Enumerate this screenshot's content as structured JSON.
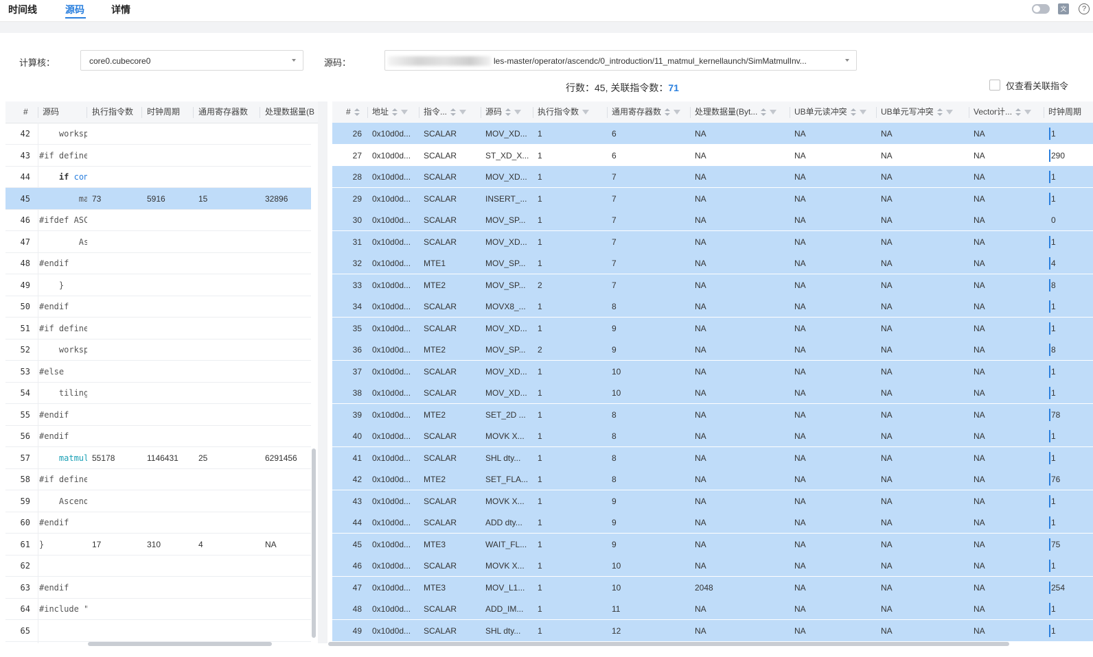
{
  "tabs": {
    "timeline": "时间线",
    "source": "源码",
    "details": "详情"
  },
  "controls": {
    "core_label": "计算核：",
    "core_value": "core0.cubecore0",
    "source_label": "源码：",
    "source_value": "les-master/operator/ascendc/0_introduction/11_matmul_kernellaunch/SimMatmulInv...",
    "summary_prefix": "行数：45, 关联指令数：",
    "summary_count": "71",
    "only_related_label": "仅查看关联指令"
  },
  "left_table": {
    "columns": [
      "#",
      "源码",
      "执行指令数",
      "时钟周期",
      "通用寄存器数",
      "处理数据量(B"
    ],
    "rows": [
      {
        "line": "42",
        "code": "    worksp",
        "exec": "",
        "cycles": "",
        "regs": "",
        "data": "",
        "sel": false
      },
      {
        "line": "43",
        "code": "#if define",
        "exec": "",
        "cycles": "",
        "regs": "",
        "data": "",
        "sel": false
      },
      {
        "line": "44",
        "code": "    if con",
        "exec": "",
        "cycles": "",
        "regs": "",
        "data": "",
        "sel": false
      },
      {
        "line": "45",
        "code": "        ma",
        "exec": "73",
        "cycles": "5916",
        "regs": "15",
        "data": "32896",
        "sel": true
      },
      {
        "line": "46",
        "code": "#ifdef ASC",
        "exec": "",
        "cycles": "",
        "regs": "",
        "data": "",
        "sel": false
      },
      {
        "line": "47",
        "code": "        As",
        "exec": "",
        "cycles": "",
        "regs": "",
        "data": "",
        "sel": false
      },
      {
        "line": "48",
        "code": "#endif",
        "exec": "",
        "cycles": "",
        "regs": "",
        "data": "",
        "sel": false
      },
      {
        "line": "49",
        "code": "    }",
        "exec": "",
        "cycles": "",
        "regs": "",
        "data": "",
        "sel": false
      },
      {
        "line": "50",
        "code": "#endif",
        "exec": "",
        "cycles": "",
        "regs": "",
        "data": "",
        "sel": false
      },
      {
        "line": "51",
        "code": "#if define",
        "exec": "",
        "cycles": "",
        "regs": "",
        "data": "",
        "sel": false
      },
      {
        "line": "52",
        "code": "    worksp",
        "exec": "",
        "cycles": "",
        "regs": "",
        "data": "",
        "sel": false
      },
      {
        "line": "53",
        "code": "#else",
        "exec": "",
        "cycles": "",
        "regs": "",
        "data": "",
        "sel": false
      },
      {
        "line": "54",
        "code": "    tiling",
        "exec": "",
        "cycles": "",
        "regs": "",
        "data": "",
        "sel": false
      },
      {
        "line": "55",
        "code": "#endif",
        "exec": "",
        "cycles": "",
        "regs": "",
        "data": "",
        "sel": false
      },
      {
        "line": "56",
        "code": "#endif",
        "exec": "",
        "cycles": "",
        "regs": "",
        "data": "",
        "sel": false
      },
      {
        "line": "57",
        "code": "    matmul",
        "exec": "55178",
        "cycles": "1146431",
        "regs": "25",
        "data": "6291456",
        "sel": false
      },
      {
        "line": "58",
        "code": "#if define",
        "exec": "",
        "cycles": "",
        "regs": "",
        "data": "",
        "sel": false
      },
      {
        "line": "59",
        "code": "    Ascend",
        "exec": "",
        "cycles": "",
        "regs": "",
        "data": "",
        "sel": false
      },
      {
        "line": "60",
        "code": "#endif",
        "exec": "",
        "cycles": "",
        "regs": "",
        "data": "",
        "sel": false
      },
      {
        "line": "61",
        "code": "}",
        "exec": "17",
        "cycles": "310",
        "regs": "4",
        "data": "NA",
        "sel": false
      },
      {
        "line": "62",
        "code": "",
        "exec": "",
        "cycles": "",
        "regs": "",
        "data": "",
        "sel": false
      },
      {
        "line": "63",
        "code": "#endif",
        "exec": "",
        "cycles": "",
        "regs": "",
        "data": "",
        "sel": false
      },
      {
        "line": "64",
        "code": "#include \"",
        "exec": "",
        "cycles": "",
        "regs": "",
        "data": "",
        "sel": false
      },
      {
        "line": "65",
        "code": "",
        "exec": "",
        "cycles": "",
        "regs": "",
        "data": "",
        "sel": false
      }
    ]
  },
  "right_table": {
    "columns": [
      "#",
      "地址",
      "指令...",
      "源码",
      "执行指令数",
      "通用寄存器数",
      "处理数据量(Byt...",
      "UB单元读冲突",
      "UB单元写冲突",
      "Vector计...",
      "时钟周期"
    ],
    "rows": [
      {
        "n": "26",
        "addr": "0x10d0d...",
        "pipe": "SCALAR",
        "instr": "MOV_XD...",
        "exec": "1",
        "regs": "6",
        "data": "NA",
        "ubr": "NA",
        "ubw": "NA",
        "vec": "NA",
        "clk": "1",
        "clk_frac": 0.003,
        "sel": true
      },
      {
        "n": "27",
        "addr": "0x10d0d...",
        "pipe": "SCALAR",
        "instr": "ST_XD_X...",
        "exec": "1",
        "regs": "6",
        "data": "NA",
        "ubr": "NA",
        "ubw": "NA",
        "vec": "NA",
        "clk": "290",
        "clk_frac": 0.003,
        "sel": false
      },
      {
        "n": "28",
        "addr": "0x10d0d...",
        "pipe": "SCALAR",
        "instr": "MOV_XD...",
        "exec": "1",
        "regs": "7",
        "data": "NA",
        "ubr": "NA",
        "ubw": "NA",
        "vec": "NA",
        "clk": "1",
        "clk_frac": 0.003,
        "sel": true
      },
      {
        "n": "29",
        "addr": "0x10d0d...",
        "pipe": "SCALAR",
        "instr": "INSERT_...",
        "exec": "1",
        "regs": "7",
        "data": "NA",
        "ubr": "NA",
        "ubw": "NA",
        "vec": "NA",
        "clk": "1",
        "clk_frac": 0.003,
        "sel": true
      },
      {
        "n": "30",
        "addr": "0x10d0d...",
        "pipe": "SCALAR",
        "instr": "MOV_SP...",
        "exec": "1",
        "regs": "7",
        "data": "NA",
        "ubr": "NA",
        "ubw": "NA",
        "vec": "NA",
        "clk": "0",
        "clk_frac": 0,
        "sel": true
      },
      {
        "n": "31",
        "addr": "0x10d0d...",
        "pipe": "SCALAR",
        "instr": "MOV_XD...",
        "exec": "1",
        "regs": "7",
        "data": "NA",
        "ubr": "NA",
        "ubw": "NA",
        "vec": "NA",
        "clk": "1",
        "clk_frac": 0.003,
        "sel": true
      },
      {
        "n": "32",
        "addr": "0x10d0d...",
        "pipe": "MTE1",
        "instr": "MOV_SP...",
        "exec": "1",
        "regs": "7",
        "data": "NA",
        "ubr": "NA",
        "ubw": "NA",
        "vec": "NA",
        "clk": "4",
        "clk_frac": 0.003,
        "sel": true
      },
      {
        "n": "33",
        "addr": "0x10d0d...",
        "pipe": "MTE2",
        "instr": "MOV_SP...",
        "exec": "2",
        "regs": "7",
        "data": "NA",
        "ubr": "NA",
        "ubw": "NA",
        "vec": "NA",
        "clk": "8",
        "clk_frac": 0.003,
        "sel": true
      },
      {
        "n": "34",
        "addr": "0x10d0d...",
        "pipe": "SCALAR",
        "instr": "MOVX8_...",
        "exec": "1",
        "regs": "8",
        "data": "NA",
        "ubr": "NA",
        "ubw": "NA",
        "vec": "NA",
        "clk": "1",
        "clk_frac": 0.003,
        "sel": true
      },
      {
        "n": "35",
        "addr": "0x10d0d...",
        "pipe": "SCALAR",
        "instr": "MOV_XD...",
        "exec": "1",
        "regs": "9",
        "data": "NA",
        "ubr": "NA",
        "ubw": "NA",
        "vec": "NA",
        "clk": "1",
        "clk_frac": 0.003,
        "sel": true
      },
      {
        "n": "36",
        "addr": "0x10d0d...",
        "pipe": "MTE2",
        "instr": "MOV_SP...",
        "exec": "2",
        "regs": "9",
        "data": "NA",
        "ubr": "NA",
        "ubw": "NA",
        "vec": "NA",
        "clk": "8",
        "clk_frac": 0.003,
        "sel": true
      },
      {
        "n": "37",
        "addr": "0x10d0d...",
        "pipe": "SCALAR",
        "instr": "MOV_XD...",
        "exec": "1",
        "regs": "10",
        "data": "NA",
        "ubr": "NA",
        "ubw": "NA",
        "vec": "NA",
        "clk": "1",
        "clk_frac": 0.003,
        "sel": true
      },
      {
        "n": "38",
        "addr": "0x10d0d...",
        "pipe": "SCALAR",
        "instr": "MOV_XD...",
        "exec": "1",
        "regs": "10",
        "data": "NA",
        "ubr": "NA",
        "ubw": "NA",
        "vec": "NA",
        "clk": "1",
        "clk_frac": 0.003,
        "sel": true
      },
      {
        "n": "39",
        "addr": "0x10d0d...",
        "pipe": "MTE2",
        "instr": "SET_2D ...",
        "exec": "1",
        "regs": "8",
        "data": "NA",
        "ubr": "NA",
        "ubw": "NA",
        "vec": "NA",
        "clk": "78",
        "clk_frac": 0.003,
        "sel": true
      },
      {
        "n": "40",
        "addr": "0x10d0d...",
        "pipe": "SCALAR",
        "instr": "MOVK X...",
        "exec": "1",
        "regs": "8",
        "data": "NA",
        "ubr": "NA",
        "ubw": "NA",
        "vec": "NA",
        "clk": "1",
        "clk_frac": 0.003,
        "sel": true
      },
      {
        "n": "41",
        "addr": "0x10d0d...",
        "pipe": "SCALAR",
        "instr": "SHL dty...",
        "exec": "1",
        "regs": "8",
        "data": "NA",
        "ubr": "NA",
        "ubw": "NA",
        "vec": "NA",
        "clk": "1",
        "clk_frac": 0.003,
        "sel": true
      },
      {
        "n": "42",
        "addr": "0x10d0d...",
        "pipe": "MTE2",
        "instr": "SET_FLA...",
        "exec": "1",
        "regs": "8",
        "data": "NA",
        "ubr": "NA",
        "ubw": "NA",
        "vec": "NA",
        "clk": "76",
        "clk_frac": 0.003,
        "sel": true
      },
      {
        "n": "43",
        "addr": "0x10d0d...",
        "pipe": "SCALAR",
        "instr": "MOVK X...",
        "exec": "1",
        "regs": "9",
        "data": "NA",
        "ubr": "NA",
        "ubw": "NA",
        "vec": "NA",
        "clk": "1",
        "clk_frac": 0.003,
        "sel": true
      },
      {
        "n": "44",
        "addr": "0x10d0d...",
        "pipe": "SCALAR",
        "instr": "ADD dty...",
        "exec": "1",
        "regs": "9",
        "data": "NA",
        "ubr": "NA",
        "ubw": "NA",
        "vec": "NA",
        "clk": "1",
        "clk_frac": 0.003,
        "sel": true
      },
      {
        "n": "45",
        "addr": "0x10d0d...",
        "pipe": "MTE3",
        "instr": "WAIT_FL...",
        "exec": "1",
        "regs": "9",
        "data": "NA",
        "ubr": "NA",
        "ubw": "NA",
        "vec": "NA",
        "clk": "75",
        "clk_frac": 0.003,
        "sel": true
      },
      {
        "n": "46",
        "addr": "0x10d0d...",
        "pipe": "SCALAR",
        "instr": "MOVK X...",
        "exec": "1",
        "regs": "10",
        "data": "NA",
        "ubr": "NA",
        "ubw": "NA",
        "vec": "NA",
        "clk": "1",
        "clk_frac": 0.003,
        "sel": true
      },
      {
        "n": "47",
        "addr": "0x10d0d...",
        "pipe": "MTE3",
        "instr": "MOV_L1...",
        "exec": "1",
        "regs": "10",
        "data": "2048",
        "ubr": "NA",
        "ubw": "NA",
        "vec": "NA",
        "clk": "254",
        "clk_frac": 0.003,
        "sel": true
      },
      {
        "n": "48",
        "addr": "0x10d0d...",
        "pipe": "SCALAR",
        "instr": "ADD_IM...",
        "exec": "1",
        "regs": "11",
        "data": "NA",
        "ubr": "NA",
        "ubw": "NA",
        "vec": "NA",
        "clk": "1",
        "clk_frac": 0.003,
        "sel": true
      },
      {
        "n": "49",
        "addr": "0x10d0d...",
        "pipe": "SCALAR",
        "instr": "SHL dty...",
        "exec": "1",
        "regs": "12",
        "data": "NA",
        "ubr": "NA",
        "ubw": "NA",
        "vec": "NA",
        "clk": "1",
        "clk_frac": 0.003,
        "sel": true
      }
    ]
  },
  "colors": {
    "accent": "#2a7fde",
    "row_selected": "#bfdcf9",
    "header_bg": "#f5f6f8"
  },
  "icons": {
    "toggle": "toggle-switch",
    "lang": "language-icon",
    "help": "help-icon",
    "caret": "chevron-down-icon",
    "sort": "sort-icon",
    "filter": "filter-icon"
  }
}
